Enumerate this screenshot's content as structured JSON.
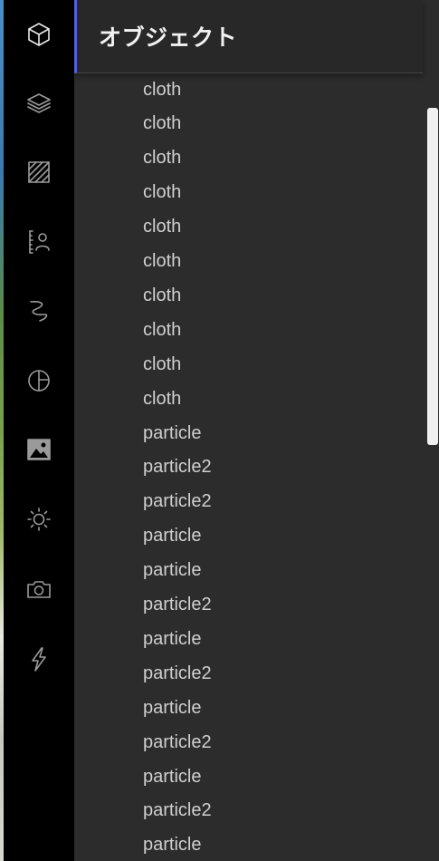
{
  "panel": {
    "title": "オブジェクト"
  },
  "toolbar": {
    "tools": [
      {
        "icon": "cube-icon",
        "active": true
      },
      {
        "icon": "layers-icon",
        "active": false
      },
      {
        "icon": "texture-hatch-icon",
        "active": false
      },
      {
        "icon": "person-scale-icon",
        "active": false
      },
      {
        "icon": "hair-curve-icon",
        "active": false
      },
      {
        "icon": "shading-circle-icon",
        "active": false
      },
      {
        "icon": "image-icon",
        "active": false
      },
      {
        "icon": "sun-icon",
        "active": false
      },
      {
        "icon": "camera-icon",
        "active": false
      },
      {
        "icon": "lightning-icon",
        "active": false
      }
    ]
  },
  "list": {
    "items": [
      "cloth",
      "cloth",
      "cloth",
      "cloth",
      "cloth",
      "cloth",
      "cloth",
      "cloth",
      "cloth",
      "cloth",
      "particle",
      "particle2",
      "particle2",
      "particle",
      "particle",
      "particle2",
      "particle",
      "particle2",
      "particle",
      "particle2",
      "particle",
      "particle2",
      "particle"
    ]
  },
  "scrollbar": {
    "position": 0.0,
    "visible_fraction": 0.43
  },
  "colors": {
    "accent": "#5560e0",
    "panel_bg": "#2c2c2c",
    "toolbar_bg": "#000000",
    "text": "#cfcfcf"
  }
}
